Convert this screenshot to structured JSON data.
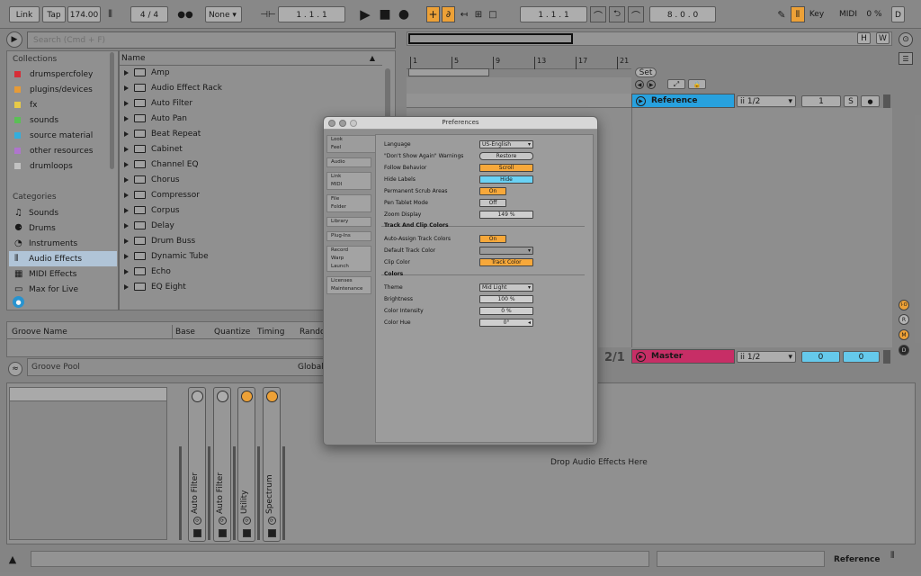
{
  "transport": {
    "link": "Link",
    "tap": "Tap",
    "tempo": "174.00",
    "time_sig": "4 / 4",
    "quantize": "None",
    "position": "1 .  1 .  1",
    "arr_position": "1 .  1 .  1",
    "loop_length": "8 .  0 .  0",
    "key": "Key",
    "midi": "MIDI",
    "cpu": "0 %",
    "disk": "D"
  },
  "browser": {
    "search_placeholder": "Search (Cmd + F)",
    "collections_header": "Collections",
    "collections": [
      {
        "label": "drumspercfoley",
        "color": "#e0303a"
      },
      {
        "label": "plugins/devices",
        "color": "#f0a23a"
      },
      {
        "label": "fx",
        "color": "#f2d34a"
      },
      {
        "label": "sounds",
        "color": "#5fc75a"
      },
      {
        "label": "source material",
        "color": "#36b6e6"
      },
      {
        "label": "other resources",
        "color": "#b77ad6"
      },
      {
        "label": "drumloops",
        "color": "#c9c9c9"
      }
    ],
    "categories_header": "Categories",
    "categories": [
      "Sounds",
      "Drums",
      "Instruments",
      "Audio Effects",
      "MIDI Effects",
      "Max for Live"
    ],
    "name_header": "Name",
    "items": [
      "Amp",
      "Audio Effect Rack",
      "Auto Filter",
      "Auto Pan",
      "Beat Repeat",
      "Cabinet",
      "Channel EQ",
      "Chorus",
      "Compressor",
      "Corpus",
      "Delay",
      "Drum Buss",
      "Dynamic Tube",
      "Echo",
      "EQ Eight"
    ]
  },
  "groove": {
    "col_name": "Groove Name",
    "col_base": "Base",
    "col_quantize": "Quantize",
    "col_timing": "Timing",
    "col_random": "Rando",
    "pool_label": "Groove Pool",
    "global_label": "Global"
  },
  "arrangement": {
    "h_btn": "H",
    "w_btn": "W",
    "ruler": [
      "1",
      "5",
      "9",
      "13",
      "17",
      "21"
    ],
    "set_label": "Set",
    "ratio": "2/1"
  },
  "tracks": [
    {
      "name": "Reference",
      "color": "#2aa8e8",
      "input": "ii 1/2",
      "number": "1",
      "solo": "S"
    },
    {
      "name": "Master",
      "color": "#d0306b",
      "input": "ii 1/2",
      "vol_left": "0",
      "vol_right": "0"
    }
  ],
  "side_letters": [
    "I·O",
    "R",
    "M",
    "D"
  ],
  "devices": {
    "chain": [
      "Auto Filter",
      "Auto Filter",
      "Utility",
      "Spectrum"
    ],
    "drop_hint": "Drop Audio Effects Here"
  },
  "status": {
    "track_name": "Reference"
  },
  "preferences": {
    "title": "Preferences",
    "tabs": [
      [
        "Look",
        "Feel"
      ],
      [
        "Audio"
      ],
      [
        "Link",
        "MIDI"
      ],
      [
        "File",
        "Folder"
      ],
      [
        "Library"
      ],
      [
        "Plug-Ins"
      ],
      [
        "Record",
        "Warp",
        "Launch"
      ],
      [
        "Licenses",
        "Maintenance"
      ]
    ],
    "language_label": "Language",
    "language_value": "US-English",
    "dont_show_label": "\"Don't Show Again\" Warnings",
    "restore_label": "Restore",
    "follow_label": "Follow Behavior",
    "follow_value": "Scroll",
    "hide_labels_label": "Hide Labels",
    "hide_labels_value": "Hide",
    "scrub_label": "Permanent Scrub Areas",
    "scrub_value": "On",
    "pen_label": "Pen Tablet Mode",
    "pen_value": "Off",
    "zoom_label": "Zoom Display",
    "zoom_value": "149 %",
    "track_clip_header": "Track And Clip Colors",
    "auto_assign_label": "Auto-Assign Track Colors",
    "auto_assign_value": "On",
    "default_color_label": "Default Track Color",
    "clip_color_label": "Clip Color",
    "clip_color_value": "Track Color",
    "colors_header": "Colors",
    "theme_label": "Theme",
    "theme_value": "Mid Light",
    "brightness_label": "Brightness",
    "brightness_value": "100 %",
    "intensity_label": "Color Intensity",
    "intensity_value": "0 %",
    "hue_label": "Color Hue",
    "hue_value": "0°"
  }
}
